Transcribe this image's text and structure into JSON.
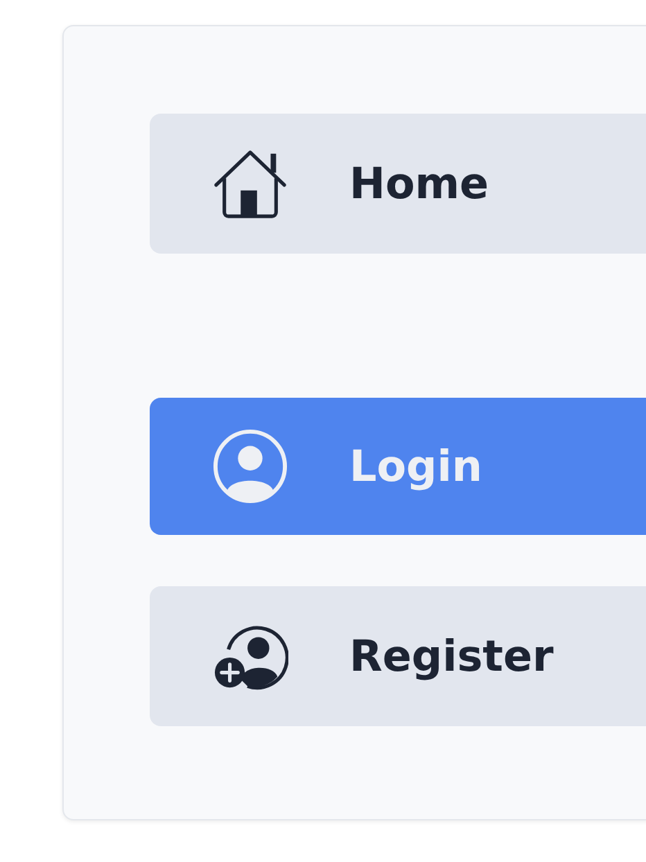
{
  "nav": {
    "main": [
      {
        "label": "Home",
        "kind": "home",
        "selected": false
      }
    ],
    "account": [
      {
        "label": "Login",
        "kind": "login",
        "selected": true
      },
      {
        "label": "Register",
        "kind": "register",
        "selected": false
      }
    ]
  }
}
